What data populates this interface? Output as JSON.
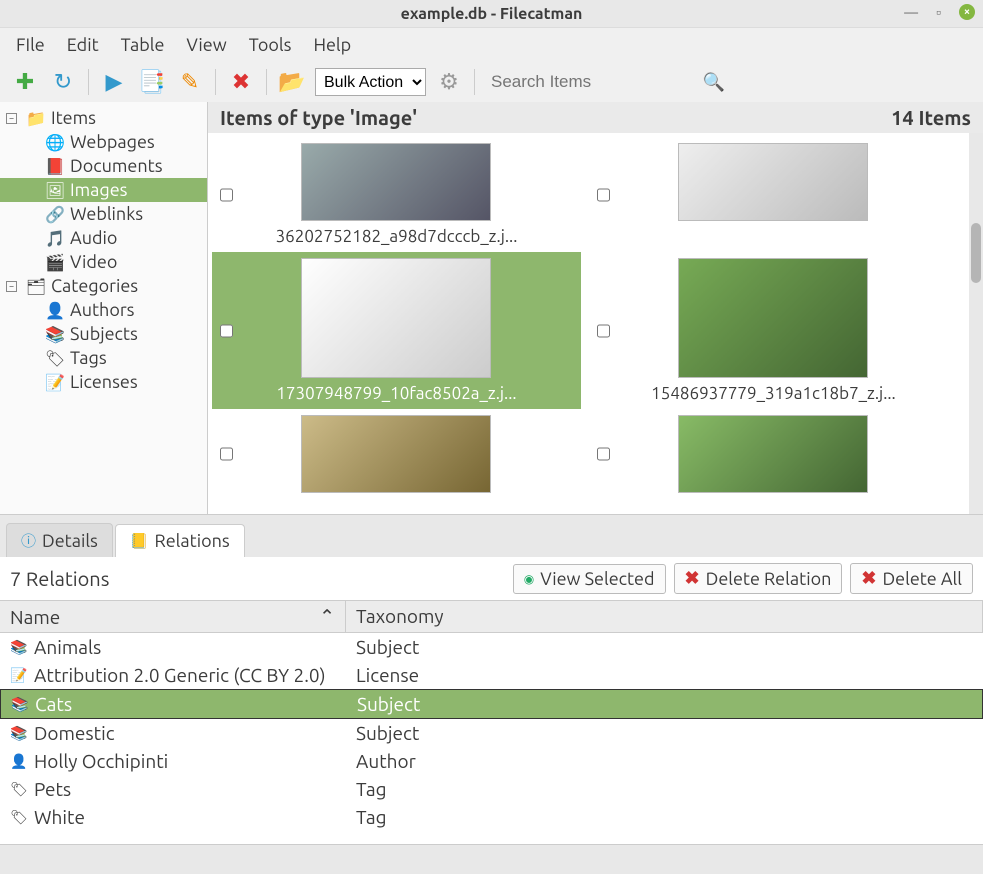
{
  "window": {
    "title": "example.db - Filecatman"
  },
  "menubar": [
    "FIle",
    "Edit",
    "Table",
    "View",
    "Tools",
    "Help"
  ],
  "toolbar": {
    "bulk_label": "Bulk Action",
    "search_placeholder": "Search Items"
  },
  "sidebar": {
    "items_label": "Items",
    "items": [
      {
        "icon": "🌐",
        "label": "Webpages"
      },
      {
        "icon": "📕",
        "label": "Documents"
      },
      {
        "icon": "🖼",
        "label": "Images",
        "selected": true
      },
      {
        "icon": "🔗",
        "label": "Weblinks"
      },
      {
        "icon": "🎵",
        "label": "Audio"
      },
      {
        "icon": "🎬",
        "label": "Video"
      }
    ],
    "categories_label": "Categories",
    "categories": [
      {
        "icon": "👤",
        "label": "Authors"
      },
      {
        "icon": "📚",
        "label": "Subjects"
      },
      {
        "icon": "🏷",
        "label": "Tags"
      },
      {
        "icon": "📝",
        "label": "Licenses"
      }
    ]
  },
  "content": {
    "header_left": "Items of type 'Image'",
    "header_right": "14 Items",
    "thumbs": [
      {
        "label": "36202752182_a98d7dcccb_z.j...",
        "selected": false,
        "imgcls": "a"
      },
      {
        "label": "",
        "selected": false,
        "imgcls": "b"
      },
      {
        "label": "17307948799_10fac8502a_z.j...",
        "selected": true,
        "imgcls": "c",
        "tall": true
      },
      {
        "label": "15486937779_319a1c18b7_z.j...",
        "selected": false,
        "imgcls": "d",
        "tall": true
      },
      {
        "label": "",
        "selected": false,
        "imgcls": "e"
      },
      {
        "label": "",
        "selected": false,
        "imgcls": "f"
      }
    ]
  },
  "tabs": {
    "details": "Details",
    "relations": "Relations"
  },
  "relations": {
    "count_label": "7 Relations",
    "view_selected": "View Selected",
    "delete_relation": "Delete Relation",
    "delete_all": "Delete All",
    "col_name": "Name",
    "col_taxonomy": "Taxonomy",
    "rows": [
      {
        "icon": "📚",
        "name": "Animals",
        "taxonomy": "Subject",
        "selected": false
      },
      {
        "icon": "📝",
        "name": "Attribution 2.0 Generic (CC BY 2.0)",
        "taxonomy": "License",
        "selected": false
      },
      {
        "icon": "📚",
        "name": "Cats",
        "taxonomy": "Subject",
        "selected": true
      },
      {
        "icon": "📚",
        "name": "Domestic",
        "taxonomy": "Subject",
        "selected": false
      },
      {
        "icon": "👤",
        "name": "Holly Occhipinti",
        "taxonomy": "Author",
        "selected": false
      },
      {
        "icon": "🏷",
        "name": "Pets",
        "taxonomy": "Tag",
        "selected": false
      },
      {
        "icon": "🏷",
        "name": "White",
        "taxonomy": "Tag",
        "selected": false
      }
    ]
  }
}
